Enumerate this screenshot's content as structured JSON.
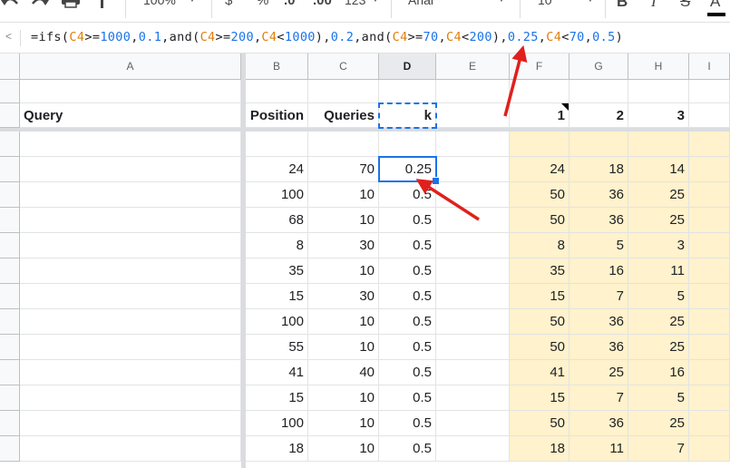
{
  "toolbar": {
    "zoom": "100%",
    "currency": "$",
    "percent": "%",
    "decrease_decimals": ".0",
    "increase_decimals": ".00",
    "more_formats": "123",
    "font": "Arial",
    "font_size": "10",
    "bold": "B",
    "italic": "I",
    "strikethrough": "S",
    "text_color": "A"
  },
  "formula_bar": {
    "tokens": [
      {
        "t": "=ifs(",
        "k": "plain"
      },
      {
        "t": "C4",
        "k": "ref"
      },
      {
        "t": ">=",
        "k": "plain"
      },
      {
        "t": "1000",
        "k": "num"
      },
      {
        "t": ",",
        "k": "plain"
      },
      {
        "t": "0.1",
        "k": "num"
      },
      {
        "t": ",and(",
        "k": "plain"
      },
      {
        "t": "C4",
        "k": "ref"
      },
      {
        "t": ">=",
        "k": "plain"
      },
      {
        "t": "200",
        "k": "num"
      },
      {
        "t": ",",
        "k": "plain"
      },
      {
        "t": "C4",
        "k": "ref"
      },
      {
        "t": "<",
        "k": "plain"
      },
      {
        "t": "1000",
        "k": "num"
      },
      {
        "t": "),",
        "k": "plain"
      },
      {
        "t": "0.2",
        "k": "num"
      },
      {
        "t": ",and(",
        "k": "plain"
      },
      {
        "t": "C4",
        "k": "ref"
      },
      {
        "t": ">=",
        "k": "plain"
      },
      {
        "t": "70",
        "k": "num"
      },
      {
        "t": ",",
        "k": "plain"
      },
      {
        "t": "C4",
        "k": "ref"
      },
      {
        "t": "<",
        "k": "plain"
      },
      {
        "t": "200",
        "k": "num"
      },
      {
        "t": "),",
        "k": "plain"
      },
      {
        "t": "0.25",
        "k": "num"
      },
      {
        "t": ",",
        "k": "plain"
      },
      {
        "t": "C4",
        "k": "ref"
      },
      {
        "t": "<",
        "k": "plain"
      },
      {
        "t": "70",
        "k": "num"
      },
      {
        "t": ",",
        "k": "plain"
      },
      {
        "t": "0.5",
        "k": "num"
      },
      {
        "t": ")",
        "k": "plain"
      }
    ]
  },
  "columns": [
    "A",
    "B",
    "C",
    "D",
    "E",
    "F",
    "G",
    "H",
    "I"
  ],
  "header_row": {
    "A": "Query",
    "B": "Position",
    "C": "Queries",
    "D": "k",
    "F": "1",
    "G": "2",
    "H": "3"
  },
  "rows": [
    {
      "B": "24",
      "C": "70",
      "D": "0.25",
      "F": "24",
      "G": "18",
      "H": "14"
    },
    {
      "B": "100",
      "C": "10",
      "D": "0.5",
      "F": "50",
      "G": "36",
      "H": "25"
    },
    {
      "B": "68",
      "C": "10",
      "D": "0.5",
      "F": "50",
      "G": "36",
      "H": "25"
    },
    {
      "B": "8",
      "C": "30",
      "D": "0.5",
      "F": "8",
      "G": "5",
      "H": "3"
    },
    {
      "B": "35",
      "C": "10",
      "D": "0.5",
      "F": "35",
      "G": "16",
      "H": "11"
    },
    {
      "B": "15",
      "C": "30",
      "D": "0.5",
      "F": "15",
      "G": "7",
      "H": "5"
    },
    {
      "B": "100",
      "C": "10",
      "D": "0.5",
      "F": "50",
      "G": "36",
      "H": "25"
    },
    {
      "B": "55",
      "C": "10",
      "D": "0.5",
      "F": "50",
      "G": "36",
      "H": "25"
    },
    {
      "B": "41",
      "C": "40",
      "D": "0.5",
      "F": "41",
      "G": "25",
      "H": "16"
    },
    {
      "B": "15",
      "C": "10",
      "D": "0.5",
      "F": "15",
      "G": "7",
      "H": "5"
    },
    {
      "B": "100",
      "C": "10",
      "D": "0.5",
      "F": "50",
      "G": "36",
      "H": "25"
    },
    {
      "B": "18",
      "C": "10",
      "D": "0.5",
      "F": "18",
      "G": "11",
      "H": "7"
    }
  ],
  "colors": {
    "accent": "#1a73e8",
    "highlight": "#fff2cc",
    "arrow": "#e0201c",
    "reference": "#e07f08"
  }
}
